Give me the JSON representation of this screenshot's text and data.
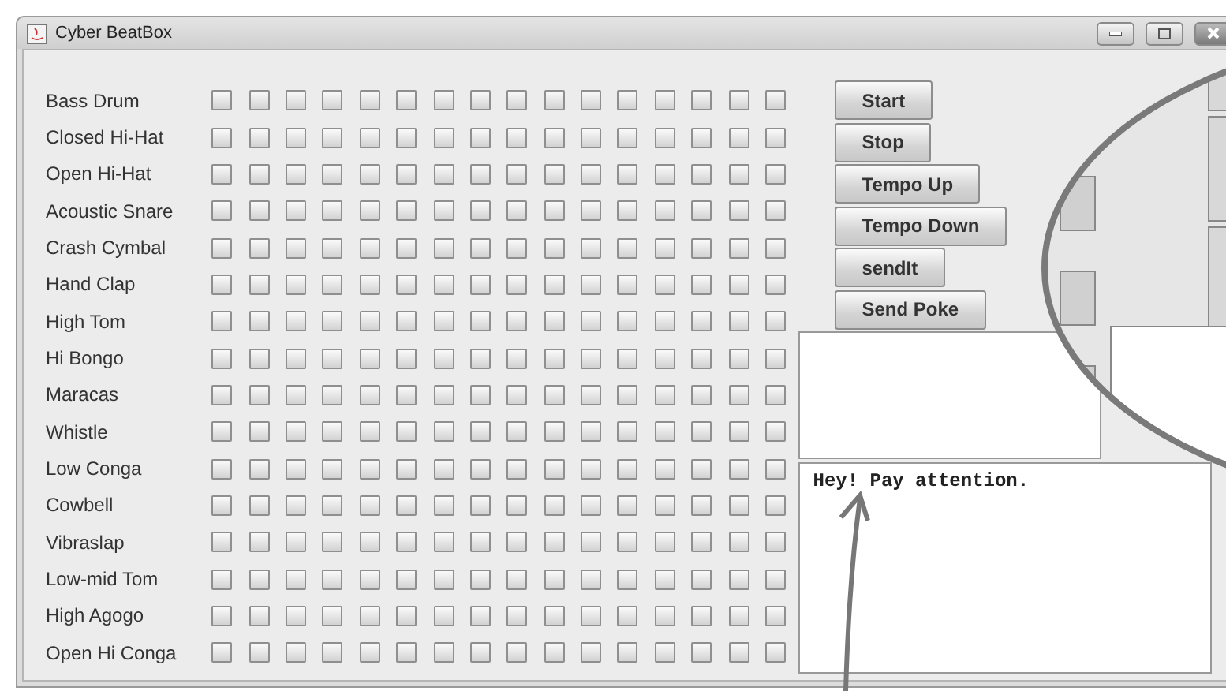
{
  "window": {
    "title": "Cyber BeatBox"
  },
  "instruments": [
    {
      "name": "Bass Drum",
      "steps": [
        {
          "checked": false
        },
        {
          "checked": false
        },
        {
          "checked": false
        },
        {
          "checked": false
        },
        {
          "checked": false
        },
        {
          "checked": false
        },
        {
          "checked": false
        },
        {
          "checked": false
        },
        {
          "checked": false
        },
        {
          "checked": false
        },
        {
          "checked": false
        },
        {
          "checked": false
        },
        {
          "checked": false
        },
        {
          "checked": false
        },
        {
          "checked": false
        },
        {
          "checked": false
        }
      ]
    },
    {
      "name": "Closed Hi-Hat",
      "steps": [
        {
          "checked": false
        },
        {
          "checked": false
        },
        {
          "checked": false
        },
        {
          "checked": false
        },
        {
          "checked": false
        },
        {
          "checked": false
        },
        {
          "checked": false
        },
        {
          "checked": false
        },
        {
          "checked": false
        },
        {
          "checked": false
        },
        {
          "checked": false
        },
        {
          "checked": false
        },
        {
          "checked": false
        },
        {
          "checked": false
        },
        {
          "checked": false
        },
        {
          "checked": false
        }
      ]
    },
    {
      "name": "Open Hi-Hat",
      "steps": [
        {
          "checked": false
        },
        {
          "checked": false
        },
        {
          "checked": false
        },
        {
          "checked": false
        },
        {
          "checked": false
        },
        {
          "checked": false
        },
        {
          "checked": false
        },
        {
          "checked": false
        },
        {
          "checked": false
        },
        {
          "checked": false
        },
        {
          "checked": false
        },
        {
          "checked": false
        },
        {
          "checked": false
        },
        {
          "checked": false
        },
        {
          "checked": false
        },
        {
          "checked": false
        }
      ]
    },
    {
      "name": "Acoustic Snare",
      "steps": [
        {
          "checked": false
        },
        {
          "checked": false
        },
        {
          "checked": false
        },
        {
          "checked": false
        },
        {
          "checked": false
        },
        {
          "checked": false
        },
        {
          "checked": false
        },
        {
          "checked": false
        },
        {
          "checked": false
        },
        {
          "checked": false
        },
        {
          "checked": false
        },
        {
          "checked": false
        },
        {
          "checked": false
        },
        {
          "checked": false
        },
        {
          "checked": false
        },
        {
          "checked": false
        }
      ]
    },
    {
      "name": "Crash Cymbal",
      "steps": [
        {
          "checked": false
        },
        {
          "checked": false
        },
        {
          "checked": false
        },
        {
          "checked": false
        },
        {
          "checked": false
        },
        {
          "checked": false
        },
        {
          "checked": false
        },
        {
          "checked": false
        },
        {
          "checked": false
        },
        {
          "checked": false
        },
        {
          "checked": false
        },
        {
          "checked": false
        },
        {
          "checked": false
        },
        {
          "checked": false
        },
        {
          "checked": false
        },
        {
          "checked": false
        }
      ]
    },
    {
      "name": "Hand Clap",
      "steps": [
        {
          "checked": false
        },
        {
          "checked": false
        },
        {
          "checked": false
        },
        {
          "checked": false
        },
        {
          "checked": false
        },
        {
          "checked": false
        },
        {
          "checked": false
        },
        {
          "checked": false
        },
        {
          "checked": false
        },
        {
          "checked": false
        },
        {
          "checked": false
        },
        {
          "checked": false
        },
        {
          "checked": false
        },
        {
          "checked": false
        },
        {
          "checked": false
        },
        {
          "checked": false
        }
      ]
    },
    {
      "name": "High Tom",
      "steps": [
        {
          "checked": false
        },
        {
          "checked": false
        },
        {
          "checked": false
        },
        {
          "checked": false
        },
        {
          "checked": false
        },
        {
          "checked": false
        },
        {
          "checked": false
        },
        {
          "checked": false
        },
        {
          "checked": false
        },
        {
          "checked": false
        },
        {
          "checked": false
        },
        {
          "checked": false
        },
        {
          "checked": false
        },
        {
          "checked": false
        },
        {
          "checked": false
        },
        {
          "checked": false
        }
      ]
    },
    {
      "name": "Hi Bongo",
      "steps": [
        {
          "checked": false
        },
        {
          "checked": false
        },
        {
          "checked": false
        },
        {
          "checked": false
        },
        {
          "checked": false
        },
        {
          "checked": false
        },
        {
          "checked": false
        },
        {
          "checked": false
        },
        {
          "checked": false
        },
        {
          "checked": false
        },
        {
          "checked": false
        },
        {
          "checked": false
        },
        {
          "checked": false
        },
        {
          "checked": false
        },
        {
          "checked": false
        },
        {
          "checked": false
        }
      ]
    },
    {
      "name": "Maracas",
      "steps": [
        {
          "checked": false
        },
        {
          "checked": false
        },
        {
          "checked": false
        },
        {
          "checked": false
        },
        {
          "checked": false
        },
        {
          "checked": false
        },
        {
          "checked": false
        },
        {
          "checked": false
        },
        {
          "checked": false
        },
        {
          "checked": false
        },
        {
          "checked": false
        },
        {
          "checked": false
        },
        {
          "checked": false
        },
        {
          "checked": false
        },
        {
          "checked": false
        },
        {
          "checked": false
        }
      ]
    },
    {
      "name": "Whistle",
      "steps": [
        {
          "checked": false
        },
        {
          "checked": false
        },
        {
          "checked": false
        },
        {
          "checked": false
        },
        {
          "checked": false
        },
        {
          "checked": false
        },
        {
          "checked": false
        },
        {
          "checked": false
        },
        {
          "checked": false
        },
        {
          "checked": false
        },
        {
          "checked": false
        },
        {
          "checked": false
        },
        {
          "checked": false
        },
        {
          "checked": false
        },
        {
          "checked": false
        },
        {
          "checked": false
        }
      ]
    },
    {
      "name": "Low Conga",
      "steps": [
        {
          "checked": false
        },
        {
          "checked": false
        },
        {
          "checked": false
        },
        {
          "checked": false
        },
        {
          "checked": false
        },
        {
          "checked": false
        },
        {
          "checked": false
        },
        {
          "checked": false
        },
        {
          "checked": false
        },
        {
          "checked": false
        },
        {
          "checked": false
        },
        {
          "checked": false
        },
        {
          "checked": false
        },
        {
          "checked": false
        },
        {
          "checked": false
        },
        {
          "checked": false
        }
      ]
    },
    {
      "name": "Cowbell",
      "steps": [
        {
          "checked": false
        },
        {
          "checked": false
        },
        {
          "checked": false
        },
        {
          "checked": false
        },
        {
          "checked": false
        },
        {
          "checked": false
        },
        {
          "checked": false
        },
        {
          "checked": false
        },
        {
          "checked": false
        },
        {
          "checked": false
        },
        {
          "checked": false
        },
        {
          "checked": false
        },
        {
          "checked": false
        },
        {
          "checked": false
        },
        {
          "checked": false
        },
        {
          "checked": false
        }
      ]
    },
    {
      "name": "Vibraslap",
      "steps": [
        {
          "checked": false
        },
        {
          "checked": false
        },
        {
          "checked": false
        },
        {
          "checked": false
        },
        {
          "checked": false
        },
        {
          "checked": false
        },
        {
          "checked": false
        },
        {
          "checked": false
        },
        {
          "checked": false
        },
        {
          "checked": false
        },
        {
          "checked": false
        },
        {
          "checked": false
        },
        {
          "checked": false
        },
        {
          "checked": false
        },
        {
          "checked": false
        },
        {
          "checked": false
        }
      ]
    },
    {
      "name": "Low-mid Tom",
      "steps": [
        {
          "checked": false
        },
        {
          "checked": false
        },
        {
          "checked": false
        },
        {
          "checked": false
        },
        {
          "checked": false
        },
        {
          "checked": false
        },
        {
          "checked": false
        },
        {
          "checked": false
        },
        {
          "checked": false
        },
        {
          "checked": false
        },
        {
          "checked": false
        },
        {
          "checked": false
        },
        {
          "checked": false
        },
        {
          "checked": false
        },
        {
          "checked": false
        },
        {
          "checked": false
        }
      ]
    },
    {
      "name": "High Agogo",
      "steps": [
        {
          "checked": false
        },
        {
          "checked": false
        },
        {
          "checked": false
        },
        {
          "checked": false
        },
        {
          "checked": false
        },
        {
          "checked": false
        },
        {
          "checked": false
        },
        {
          "checked": false
        },
        {
          "checked": false
        },
        {
          "checked": false
        },
        {
          "checked": false
        },
        {
          "checked": false
        },
        {
          "checked": false
        },
        {
          "checked": false
        },
        {
          "checked": false
        },
        {
          "checked": false
        }
      ]
    },
    {
      "name": "Open Hi Conga",
      "steps": [
        {
          "checked": false
        },
        {
          "checked": false
        },
        {
          "checked": false
        },
        {
          "checked": false
        },
        {
          "checked": false
        },
        {
          "checked": false
        },
        {
          "checked": false
        },
        {
          "checked": false
        },
        {
          "checked": false
        },
        {
          "checked": false
        },
        {
          "checked": false
        },
        {
          "checked": false
        },
        {
          "checked": false
        },
        {
          "checked": false
        },
        {
          "checked": false
        },
        {
          "checked": false
        }
      ]
    }
  ],
  "buttons": [
    "Start",
    "Stop",
    "Tempo Up",
    "Tempo Down",
    "sendIt",
    "Send Poke"
  ],
  "message_area": {
    "value": "Hey! Pay attention."
  }
}
